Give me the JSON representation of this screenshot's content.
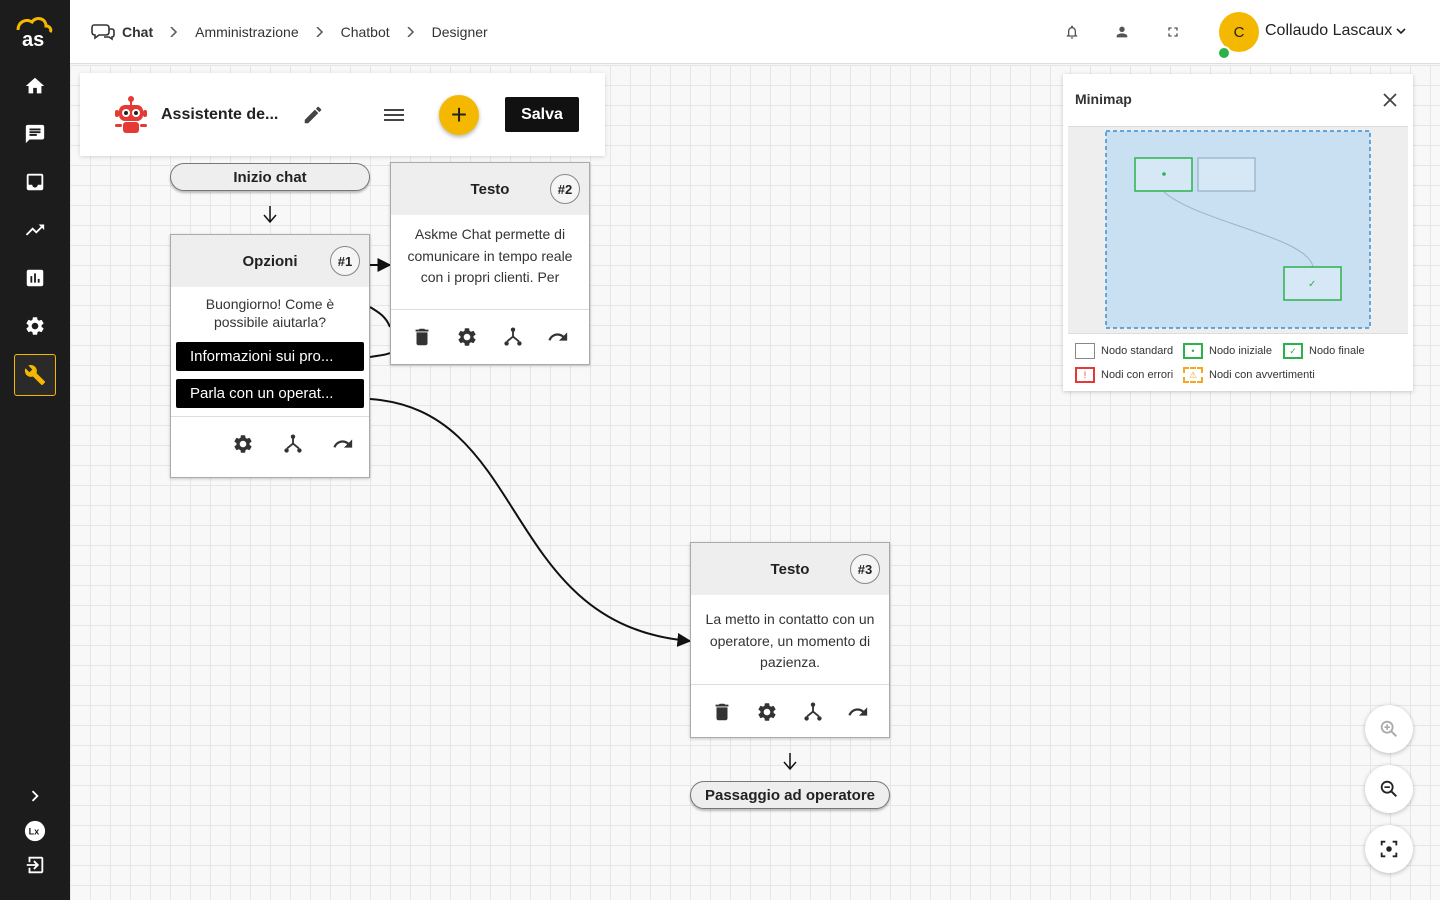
{
  "breadcrumb": {
    "items": [
      "Chat",
      "Amministrazione",
      "Chatbot",
      "Designer"
    ]
  },
  "user": {
    "initial": "C",
    "name": "Collaudo Lascaux"
  },
  "sidebar": {
    "items": [
      "home-icon",
      "chat-icon",
      "inbox-icon",
      "trend-icon",
      "stats-icon",
      "settings-icon",
      "wrench-icon"
    ],
    "bottom": [
      "expand-icon",
      "lx-icon",
      "logout-icon"
    ]
  },
  "toolbar": {
    "bot_name": "Assistente de...",
    "add_label": "+",
    "save_label": "Salva"
  },
  "flow": {
    "start_label": "Inizio chat",
    "end_label": "Passaggio ad operatore",
    "nodes": [
      {
        "title": "Opzioni",
        "number": "#1",
        "text": "Buongiorno! Come è possibile aiutarla?",
        "options": [
          "Informazioni sui pro...",
          "Parla con un operat..."
        ]
      },
      {
        "title": "Testo",
        "number": "#2",
        "text": "Askme Chat permette di comunicare in tempo reale con i propri clienti. Per"
      },
      {
        "title": "Testo",
        "number": "#3",
        "text": "La metto in contatto con un operatore, un momento di pazienza."
      }
    ]
  },
  "minimap": {
    "title": "Minimap",
    "legend": [
      "Nodo standard",
      "Nodo iniziale",
      "Nodo finale",
      "Nodi con errori",
      "Nodi con avvertimenti"
    ]
  },
  "colors": {
    "accent": "#f5b800",
    "sidebar_bg": "#1c1c1c",
    "start_node": "#2bb24c",
    "error": "#e53935",
    "warning": "#f5a623",
    "minimap_view": "#c9dff2"
  }
}
